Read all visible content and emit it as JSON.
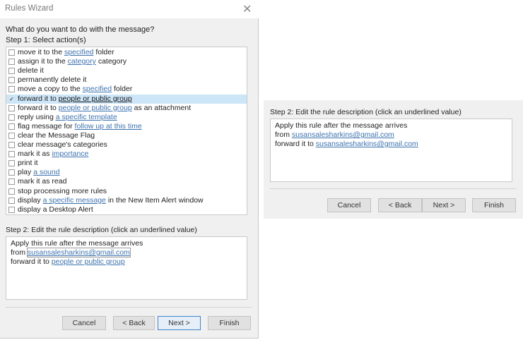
{
  "dialog": {
    "title": "Rules Wizard",
    "question": "What do you want to do with the message?",
    "step1_label": "Step 1: Select action(s)",
    "actions": [
      {
        "checked": false,
        "parts": [
          {
            "t": "move it to the "
          },
          {
            "t": "specified",
            "link": true
          },
          {
            "t": " folder"
          }
        ]
      },
      {
        "checked": false,
        "parts": [
          {
            "t": "assign it to the "
          },
          {
            "t": "category",
            "link": true
          },
          {
            "t": " category"
          }
        ]
      },
      {
        "checked": false,
        "parts": [
          {
            "t": "delete it"
          }
        ]
      },
      {
        "checked": false,
        "parts": [
          {
            "t": "permanently delete it"
          }
        ]
      },
      {
        "checked": false,
        "parts": [
          {
            "t": "move a copy to the "
          },
          {
            "t": "specified",
            "link": true
          },
          {
            "t": " folder"
          }
        ]
      },
      {
        "checked": true,
        "selected": true,
        "parts": [
          {
            "t": "forward it to "
          },
          {
            "t": "people or public group",
            "link": true
          }
        ]
      },
      {
        "checked": false,
        "parts": [
          {
            "t": "forward it to "
          },
          {
            "t": "people or public group",
            "link": true
          },
          {
            "t": " as an attachment"
          }
        ]
      },
      {
        "checked": false,
        "parts": [
          {
            "t": "reply using "
          },
          {
            "t": "a specific template",
            "link": true
          }
        ]
      },
      {
        "checked": false,
        "parts": [
          {
            "t": "flag message for "
          },
          {
            "t": "follow up at this time",
            "link": true
          }
        ]
      },
      {
        "checked": false,
        "parts": [
          {
            "t": "clear the Message Flag"
          }
        ]
      },
      {
        "checked": false,
        "parts": [
          {
            "t": "clear message's categories"
          }
        ]
      },
      {
        "checked": false,
        "parts": [
          {
            "t": "mark it as "
          },
          {
            "t": "importance",
            "link": true
          }
        ]
      },
      {
        "checked": false,
        "parts": [
          {
            "t": "print it"
          }
        ]
      },
      {
        "checked": false,
        "parts": [
          {
            "t": "play "
          },
          {
            "t": "a sound",
            "link": true
          }
        ]
      },
      {
        "checked": false,
        "parts": [
          {
            "t": "mark it as read"
          }
        ]
      },
      {
        "checked": false,
        "parts": [
          {
            "t": "stop processing more rules"
          }
        ]
      },
      {
        "checked": false,
        "parts": [
          {
            "t": "display "
          },
          {
            "t": "a specific message",
            "link": true
          },
          {
            "t": " in the New Item Alert window"
          }
        ]
      },
      {
        "checked": false,
        "parts": [
          {
            "t": "display a Desktop Alert"
          }
        ]
      }
    ],
    "step2_label": "Step 2: Edit the rule description (click an underlined value)",
    "desc": {
      "line1": "Apply this rule after the message arrives",
      "from_prefix": "from ",
      "from_value": "susansalesharkins@gmail.com",
      "fwd_prefix": "forward it to ",
      "fwd_value": "people or public group"
    },
    "buttons": {
      "cancel": "Cancel",
      "back": "< Back",
      "next": "Next >",
      "finish": "Finish"
    }
  },
  "panel": {
    "step2_label": "Step 2: Edit the rule description (click an underlined value)",
    "desc": {
      "line1": "Apply this rule after the message arrives",
      "from_prefix": "from ",
      "from_value": "susansalesharkins@gmail.com",
      "fwd_prefix": "forward it to ",
      "fwd_value": "susansalesharkins@gmail.com"
    },
    "buttons": {
      "cancel": "Cancel",
      "back": "< Back",
      "next": "Next >",
      "finish": "Finish"
    }
  }
}
